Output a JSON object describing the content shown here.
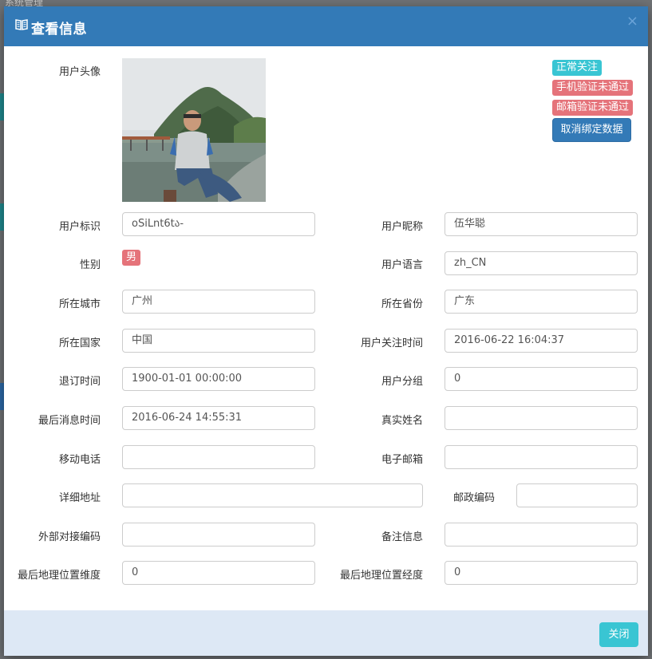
{
  "modal": {
    "title": "查看信息",
    "close_glyph": "×"
  },
  "avatar": {
    "label": "用户头像"
  },
  "status": {
    "subscribed": "正常关注",
    "phone": "手机验证未通过",
    "email": "邮箱验证未通过",
    "unbind": "取消绑定数据"
  },
  "fields": {
    "openid": {
      "label": "用户标识",
      "value": "oSiLnt6tა-"
    },
    "nickname": {
      "label": "用户昵称",
      "value": "伍华聪"
    },
    "gender": {
      "label": "性别",
      "value": "男"
    },
    "language": {
      "label": "用户语言",
      "value": "zh_CN"
    },
    "city": {
      "label": "所在城市",
      "value": "广州"
    },
    "province": {
      "label": "所在省份",
      "value": "广东"
    },
    "country": {
      "label": "所在国家",
      "value": "中国"
    },
    "subscribe_time": {
      "label": "用户关注时间",
      "value": "2016-06-22 16:04:37"
    },
    "unsubscribe_time": {
      "label": "退订时间",
      "value": "1900-01-01 00:00:00"
    },
    "group": {
      "label": "用户分组",
      "value": "0"
    },
    "last_msg_time": {
      "label": "最后消息时间",
      "value": "2016-06-24 14:55:31"
    },
    "real_name": {
      "label": "真实姓名",
      "value": ""
    },
    "mobile": {
      "label": "移动电话",
      "value": ""
    },
    "email": {
      "label": "电子邮箱",
      "value": ""
    },
    "address": {
      "label": "详细地址",
      "value": ""
    },
    "postcode": {
      "label": "邮政编码",
      "value": ""
    },
    "external_code": {
      "label": "外部对接编码",
      "value": ""
    },
    "remark": {
      "label": "备注信息",
      "value": ""
    },
    "latitude": {
      "label": "最后地理位置维度",
      "value": "0"
    },
    "longitude": {
      "label": "最后地理位置经度",
      "value": "0"
    }
  },
  "footer": {
    "close_label": "关闭"
  },
  "colors": {
    "header": "#337ab7",
    "subscribed": "#39c5d3",
    "danger": "#e5737a",
    "footer": "#dde8f5"
  },
  "background": {
    "title": "系统管理"
  }
}
